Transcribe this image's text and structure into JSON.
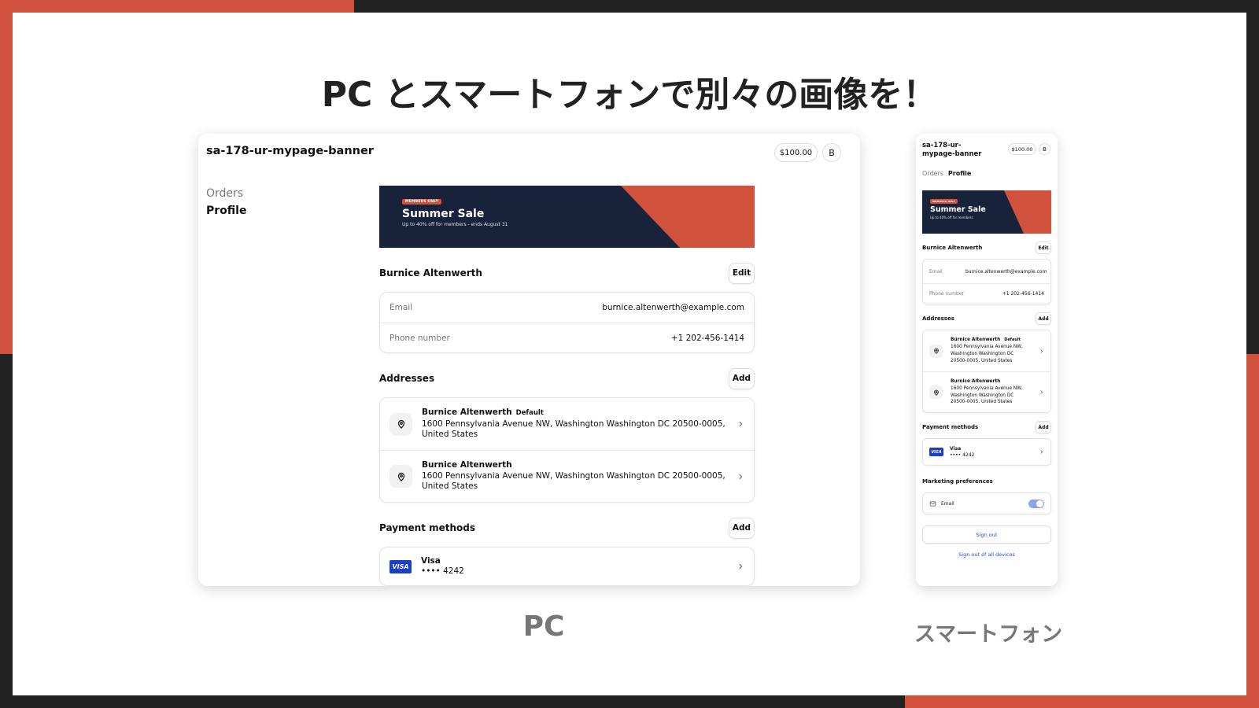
{
  "slide": {
    "title": "PC とスマートフォンで別々の画像を！",
    "caption_pc": "PC",
    "caption_sp": "スマートフォン"
  },
  "colors": {
    "accent": "#d0523d",
    "banner_bg": "#18223a",
    "link": "#1e4fd1",
    "visa": "#1a3fc9"
  },
  "pc": {
    "store": "sa-178-ur-mypage-banner",
    "balance": "$100.00",
    "avatar": "B",
    "nav": {
      "orders": "Orders",
      "profile": "Profile"
    },
    "banner": {
      "badge": "MEMBERS ONLY",
      "title": "Summer Sale",
      "subtitle": "Up to 40% off for members - ends August 31"
    },
    "profile": {
      "name": "Burnice Altenwerth",
      "edit": "Edit",
      "email_label": "Email",
      "email": "burnice.altenwerth@example.com",
      "phone_label": "Phone number",
      "phone": "+1 202-456-1414"
    },
    "addresses": {
      "title": "Addresses",
      "add": "Add",
      "items": [
        {
          "name": "Burnice Altenwerth",
          "default": "Default",
          "line1": "1600 Pennsylvania Avenue NW, Washington Washington DC 20500-0005,",
          "line2": "United States"
        },
        {
          "name": "Burnice Altenwerth",
          "line1": "1600 Pennsylvania Avenue NW, Washington Washington DC 20500-0005,",
          "line2": "United States"
        }
      ]
    },
    "payments": {
      "title": "Payment methods",
      "add": "Add",
      "items": [
        {
          "brand": "VISA",
          "name": "Visa",
          "number": "•••• 4242"
        }
      ]
    }
  },
  "sp": {
    "store_line1": "sa-178-ur-",
    "store_line2": "mypage-banner",
    "balance": "$100.00",
    "avatar": "B",
    "nav": {
      "orders": "Orders",
      "profile": "Profile"
    },
    "banner": {
      "badge": "MEMBERS ONLY",
      "title": "Summer Sale",
      "subtitle": "Up to 40% off for members"
    },
    "profile": {
      "name": "Burnice Altenwerth",
      "edit": "Edit",
      "email_label": "Email",
      "email": "burnice.altenwerth@example.com",
      "phone_label": "Phone number",
      "phone": "+1 202-456-1414"
    },
    "addresses": {
      "title": "Addresses",
      "add": "Add",
      "items": [
        {
          "name": "Burnice Altenwerth",
          "default": "Default",
          "line1": "1600 Pennsylvania Avenue NW,",
          "line2": "Washington Washington DC",
          "line3": "20500-0005, United States"
        },
        {
          "name": "Burnice Altenwerth",
          "line1": "1600 Pennsylvania Avenue NW,",
          "line2": "Washington Washington DC",
          "line3": "20500-0005, United States"
        }
      ]
    },
    "payments": {
      "title": "Payment methods",
      "add": "Add",
      "items": [
        {
          "brand": "VISA",
          "name": "Visa",
          "number": "•••• 4242"
        }
      ]
    },
    "marketing": {
      "title": "Marketing preferences",
      "email_label": "Email",
      "email_enabled": true
    },
    "signout": "Sign out",
    "signout_all": "Sign out of all devices"
  }
}
